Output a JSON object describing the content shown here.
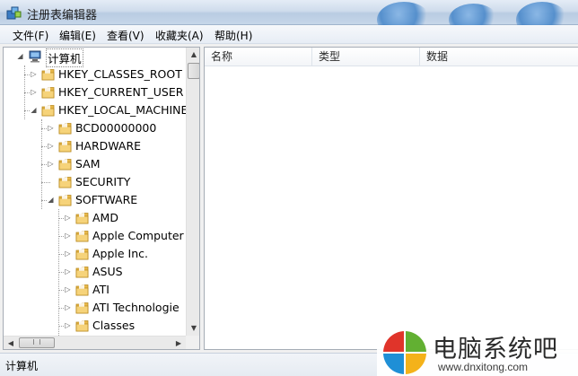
{
  "window": {
    "title": "注册表编辑器"
  },
  "menu": [
    {
      "label": "文件(F)"
    },
    {
      "label": "编辑(E)"
    },
    {
      "label": "查看(V)"
    },
    {
      "label": "收藏夹(A)"
    },
    {
      "label": "帮助(H)"
    }
  ],
  "tree": {
    "root": "计算机",
    "rows": [
      {
        "label": "HKEY_CLASSES_ROOT",
        "level": 1,
        "expander": "collapsed"
      },
      {
        "label": "HKEY_CURRENT_USER",
        "level": 1,
        "expander": "collapsed"
      },
      {
        "label": "HKEY_LOCAL_MACHINE",
        "level": 1,
        "expander": "expanded"
      },
      {
        "label": "BCD00000000",
        "level": 2,
        "expander": "collapsed"
      },
      {
        "label": "HARDWARE",
        "level": 2,
        "expander": "collapsed"
      },
      {
        "label": "SAM",
        "level": 2,
        "expander": "collapsed"
      },
      {
        "label": "SECURITY",
        "level": 2,
        "expander": "none"
      },
      {
        "label": "SOFTWARE",
        "level": 2,
        "expander": "expanded"
      },
      {
        "label": "AMD",
        "level": 3,
        "expander": "collapsed"
      },
      {
        "label": "Apple Computer",
        "level": 3,
        "expander": "collapsed"
      },
      {
        "label": "Apple Inc.",
        "level": 3,
        "expander": "collapsed"
      },
      {
        "label": "ASUS",
        "level": 3,
        "expander": "collapsed"
      },
      {
        "label": "ATI",
        "level": 3,
        "expander": "collapsed"
      },
      {
        "label": "ATI Technologie",
        "level": 3,
        "expander": "collapsed"
      },
      {
        "label": "Classes",
        "level": 3,
        "expander": "collapsed"
      }
    ]
  },
  "list": {
    "columns": [
      {
        "label": "名称"
      },
      {
        "label": "类型"
      },
      {
        "label": "数据"
      }
    ]
  },
  "status": {
    "path": "计算机"
  },
  "watermark": {
    "title": "电脑系统吧",
    "url": "www.dnxitong.com"
  },
  "colors": {
    "folder": "#e8b84a",
    "selection_border": "#888888",
    "logo_red": "#e0342a",
    "logo_green": "#62b032",
    "logo_blue": "#1f8fd6",
    "logo_yellow": "#f4b21a"
  }
}
